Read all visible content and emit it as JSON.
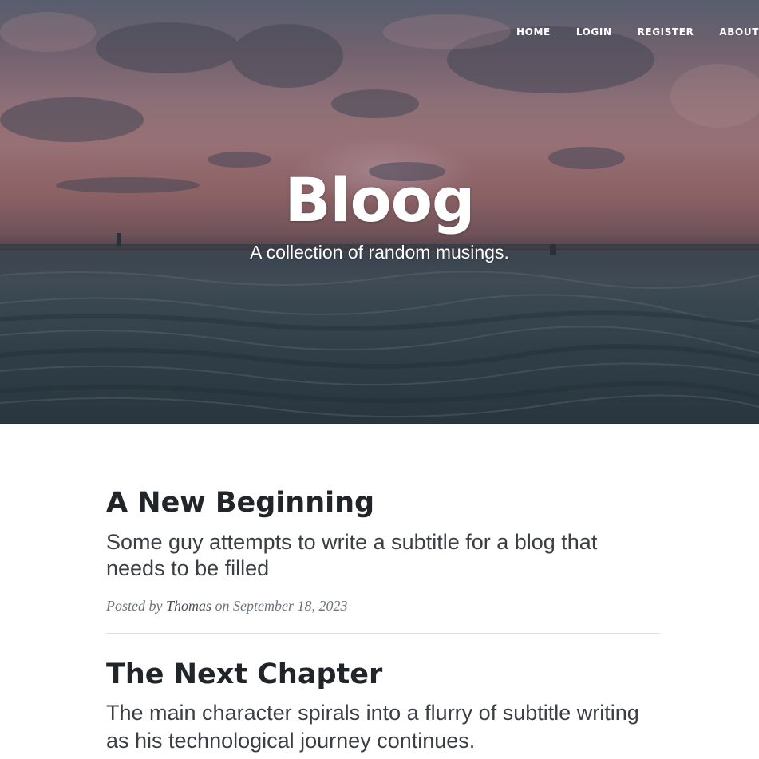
{
  "nav": {
    "items": [
      {
        "label": "HOME"
      },
      {
        "label": "LOGIN"
      },
      {
        "label": "REGISTER"
      },
      {
        "label": "ABOUT"
      }
    ]
  },
  "header": {
    "title": "Bloog",
    "subtitle": "A collection of random musings."
  },
  "posts": [
    {
      "title": "A New Beginning",
      "subtitle": "Some guy attempts to write a subtitle for a blog that needs to be filled",
      "meta_prefix": "Posted by",
      "author": "Thomas",
      "meta_on": "on",
      "date": "September 18, 2023"
    },
    {
      "title": "The Next Chapter",
      "subtitle": "The main character spirals into a flurry of subtitle writing as his technological journey continues."
    }
  ],
  "colors": {
    "heading_text": "#212529",
    "subtitle_text": "#3b3f44",
    "meta_text": "#6c757d",
    "divider": "#dee2e6",
    "nav_text": "#ffffff"
  }
}
